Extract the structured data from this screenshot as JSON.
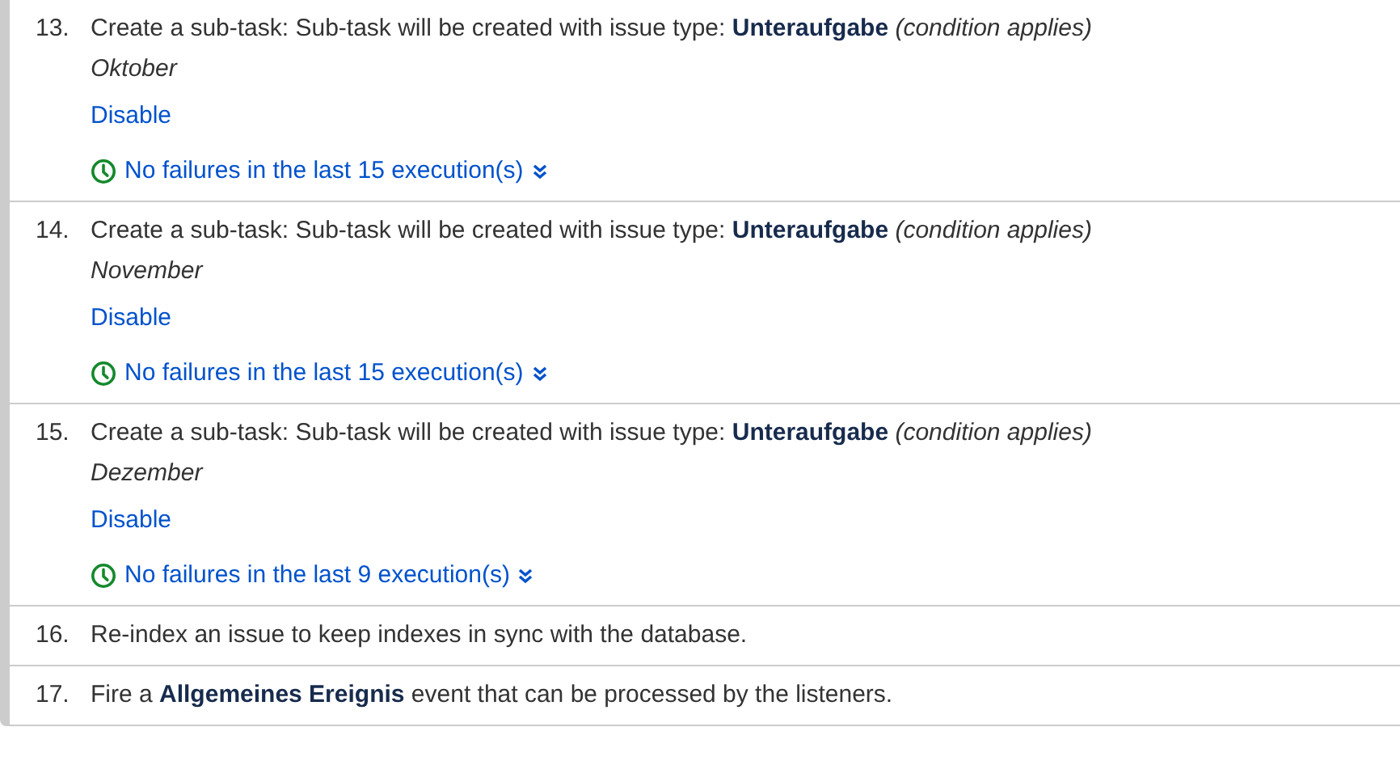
{
  "rules": [
    {
      "number": "13.",
      "text": "Create a sub-task: Sub-task will be created with issue type: **Unteraufgabe** *(condition applies)*",
      "detail": "Oktober",
      "action": "Disable",
      "status": "No failures in the last 15 execution(s)"
    },
    {
      "number": "14.",
      "text": "Create a sub-task: Sub-task will be created with issue type: **Unteraufgabe** *(condition applies)*",
      "detail": "November",
      "action": "Disable",
      "status": "No failures in the last 15 execution(s)"
    },
    {
      "number": "15.",
      "text": "Create a sub-task: Sub-task will be created with issue type: **Unteraufgabe** *(condition applies)*",
      "detail": "Dezember",
      "action": "Disable",
      "status": "No failures in the last 9 execution(s)"
    },
    {
      "number": "16.",
      "text": "Re-index an issue to keep indexes in sync with the database."
    },
    {
      "number": "17.",
      "text": "Fire a **Allgemeines Ereignis** event that can be processed by the listeners."
    }
  ]
}
